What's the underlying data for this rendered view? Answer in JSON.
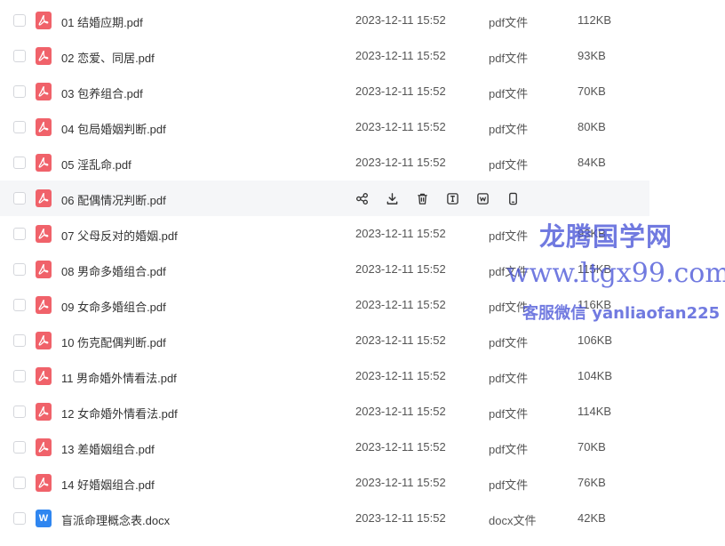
{
  "files": [
    {
      "name": "01 结婚应期.pdf",
      "date": "2023-12-11 15:52",
      "type": "pdf文件",
      "size": "112KB",
      "icon": "pdf-icon"
    },
    {
      "name": "02 恋爱、同居.pdf",
      "date": "2023-12-11 15:52",
      "type": "pdf文件",
      "size": "93KB",
      "icon": "pdf-icon"
    },
    {
      "name": "03 包养组合.pdf",
      "date": "2023-12-11 15:52",
      "type": "pdf文件",
      "size": "70KB",
      "icon": "pdf-icon"
    },
    {
      "name": "04 包局婚姻判断.pdf",
      "date": "2023-12-11 15:52",
      "type": "pdf文件",
      "size": "80KB",
      "icon": "pdf-icon"
    },
    {
      "name": "05 淫乱命.pdf",
      "date": "2023-12-11 15:52",
      "type": "pdf文件",
      "size": "84KB",
      "icon": "pdf-icon"
    },
    {
      "name": "06 配偶情况判断.pdf",
      "date": "",
      "type": "",
      "size": "",
      "icon": "pdf-icon",
      "hovered": true
    },
    {
      "name": "07 父母反对的婚姻.pdf",
      "date": "2023-12-11 15:52",
      "type": "pdf文件",
      "size": "93KB",
      "icon": "pdf-icon"
    },
    {
      "name": "08 男命多婚组合.pdf",
      "date": "2023-12-11 15:52",
      "type": "pdf文件",
      "size": "115KB",
      "icon": "pdf-icon"
    },
    {
      "name": "09 女命多婚组合.pdf",
      "date": "2023-12-11 15:52",
      "type": "pdf文件",
      "size": "116KB",
      "icon": "pdf-icon"
    },
    {
      "name": "10 伤克配偶判断.pdf",
      "date": "2023-12-11 15:52",
      "type": "pdf文件",
      "size": "106KB",
      "icon": "pdf-icon"
    },
    {
      "name": "11 男命婚外情看法.pdf",
      "date": "2023-12-11 15:52",
      "type": "pdf文件",
      "size": "104KB",
      "icon": "pdf-icon"
    },
    {
      "name": "12 女命婚外情看法.pdf",
      "date": "2023-12-11 15:52",
      "type": "pdf文件",
      "size": "114KB",
      "icon": "pdf-icon"
    },
    {
      "name": "13 差婚姻组合.pdf",
      "date": "2023-12-11 15:52",
      "type": "pdf文件",
      "size": "70KB",
      "icon": "pdf-icon"
    },
    {
      "name": "14 好婚姻组合.pdf",
      "date": "2023-12-11 15:52",
      "type": "pdf文件",
      "size": "76KB",
      "icon": "pdf-icon"
    },
    {
      "name": "盲派命理概念表.docx",
      "date": "2023-12-11 15:52",
      "type": "docx文件",
      "size": "42KB",
      "icon": "word-doc-icon"
    }
  ],
  "row_actions": [
    "share-icon",
    "download-icon",
    "delete-icon",
    "rename-icon",
    "open-with-icon",
    "mobile-icon"
  ],
  "watermark": {
    "line1": "龙腾国学网",
    "line2": "www.ltgx99.com",
    "line3": "客服微信 yanliaofan225"
  },
  "colors": {
    "pdf_icon": "#f0626a",
    "doc_icon": "#2f86f0",
    "watermark": "#4a56d8",
    "hover_row": "#f5f6f8"
  }
}
